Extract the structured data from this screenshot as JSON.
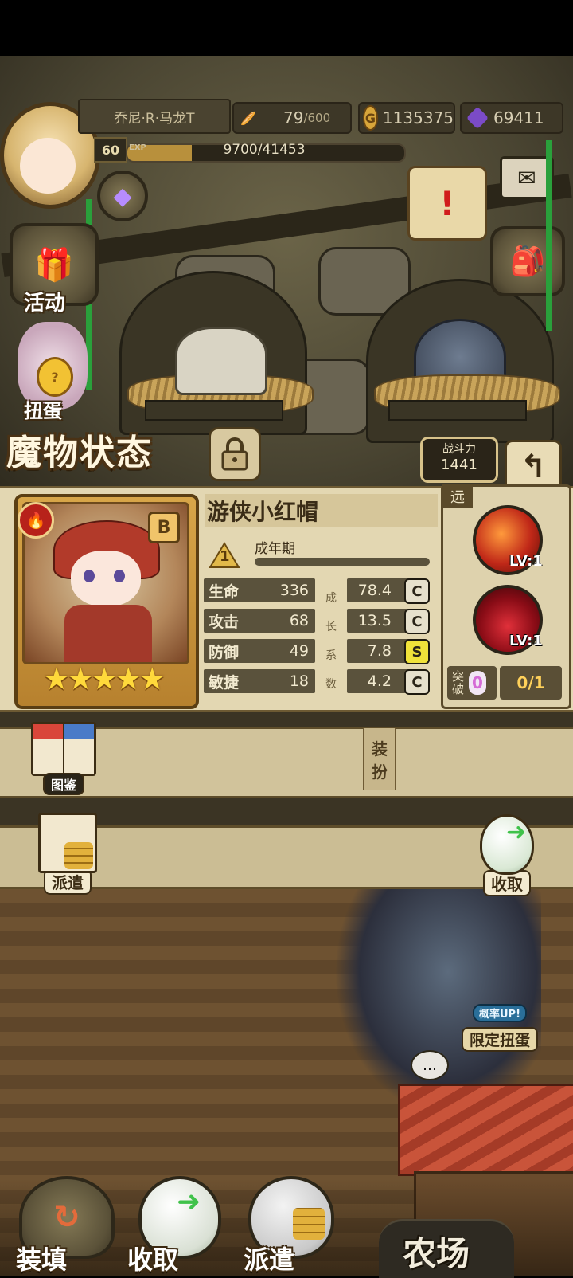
{
  "player": {
    "name": "乔尼·R·马龙T",
    "level": "60",
    "exp_label": "EXP",
    "exp_text": "9700/41453",
    "exp_progress": 0.234
  },
  "resources": {
    "stamina_value": "79",
    "stamina_max": "/600",
    "gold_icon": "G",
    "gold": "1135375",
    "gems": "69411"
  },
  "side_menu": {
    "activity_label": "活动",
    "gacha_label_partial": "扭蛋"
  },
  "monster_status": {
    "title": "魔物状态",
    "combat_power_label": "战斗力",
    "combat_power": "1441",
    "name": "游侠小红帽",
    "rank": "B",
    "stars": "★★★★★",
    "growth_stage_number": "1",
    "growth_stage": "成年期",
    "growth_coef_label": [
      "成",
      "长",
      "系",
      "数"
    ],
    "stats": [
      {
        "name": "生命",
        "value": "336",
        "coef": "78.4",
        "grade": "C"
      },
      {
        "name": "攻击",
        "value": "68",
        "coef": "13.5",
        "grade": "C"
      },
      {
        "name": "防御",
        "value": "49",
        "coef": "7.8",
        "grade": "S"
      },
      {
        "name": "敏捷",
        "value": "18",
        "coef": "4.2",
        "grade": "C"
      }
    ],
    "range_tag": "远",
    "skills": [
      {
        "level": "LV:1"
      },
      {
        "level": "LV:1"
      }
    ],
    "breakthrough_label_1": "突",
    "breakthrough_label_2": "破",
    "breakthrough_count": "0",
    "breakthrough_progress": "0/1"
  },
  "buttons": {
    "dressup_1": "装",
    "dressup_2": "扮",
    "codex": "图鉴",
    "dispatch": "派遣",
    "collect": "收取",
    "limited_gacha_1": "概率UP!",
    "limited_gacha_2": "限定扭蛋"
  },
  "bottom_nav": {
    "load": "装填",
    "collect": "收取",
    "dispatch": "派遣",
    "farm": "农场"
  },
  "colors": {
    "panel_bg": "#e3d7b2",
    "stat_bg": "#5a523c",
    "grade_c": "#e6e0cc",
    "grade_s": "#f0e23a",
    "breakthrough_count": "#d56bd6"
  }
}
